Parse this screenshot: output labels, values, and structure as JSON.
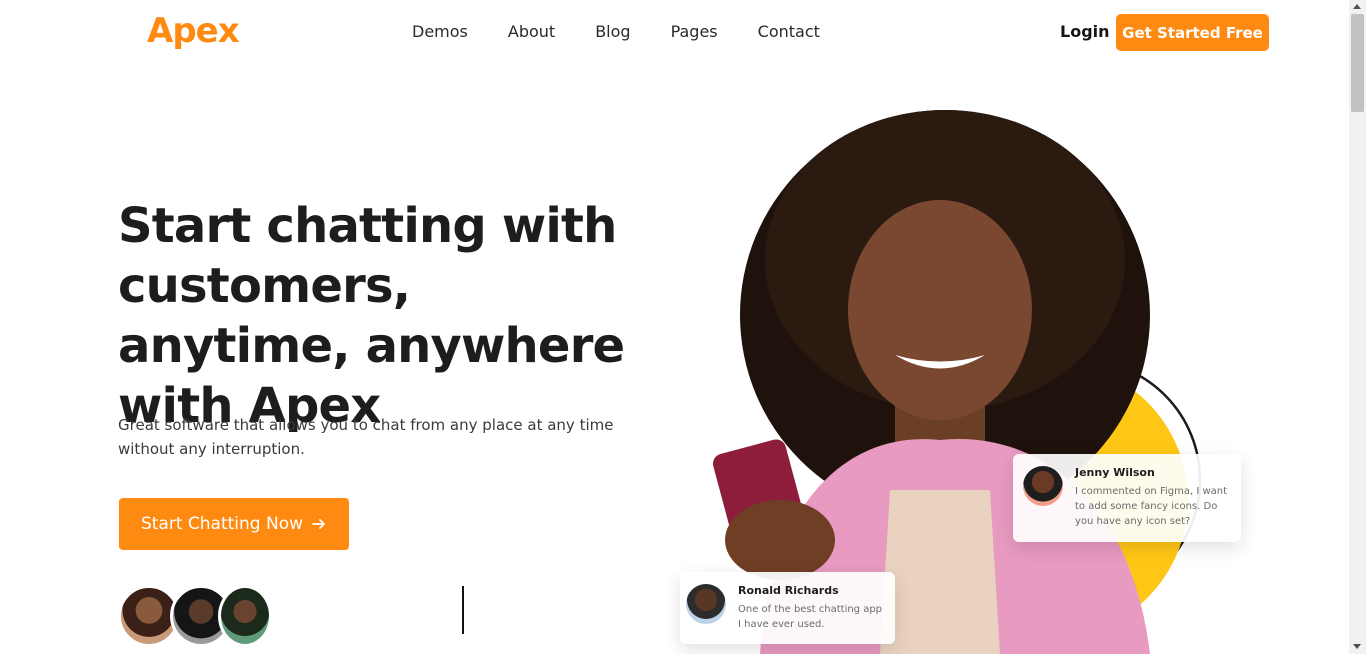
{
  "brand": {
    "logo_text": "Apex",
    "accent_color": "#ff8a12"
  },
  "nav": {
    "items": [
      "Demos",
      "About",
      "Blog",
      "Pages",
      "Contact"
    ],
    "login": "Login",
    "cta": "Get Started Free"
  },
  "hero": {
    "title": "Start chatting with customers, anytime, anywhere with Apex",
    "subtitle": "Great software that allows you to chat from any place at any time without any interruption.",
    "button": "Start Chatting Now",
    "button_icon": "arrow-right-icon"
  },
  "chats": [
    {
      "name": "Jenny Wilson",
      "message": "I commented on Figma, I want to add some fancy icons. Do you have any icon set?"
    },
    {
      "name": "Ronald Richards",
      "message": "One of the best chatting app I have ever used."
    }
  ]
}
